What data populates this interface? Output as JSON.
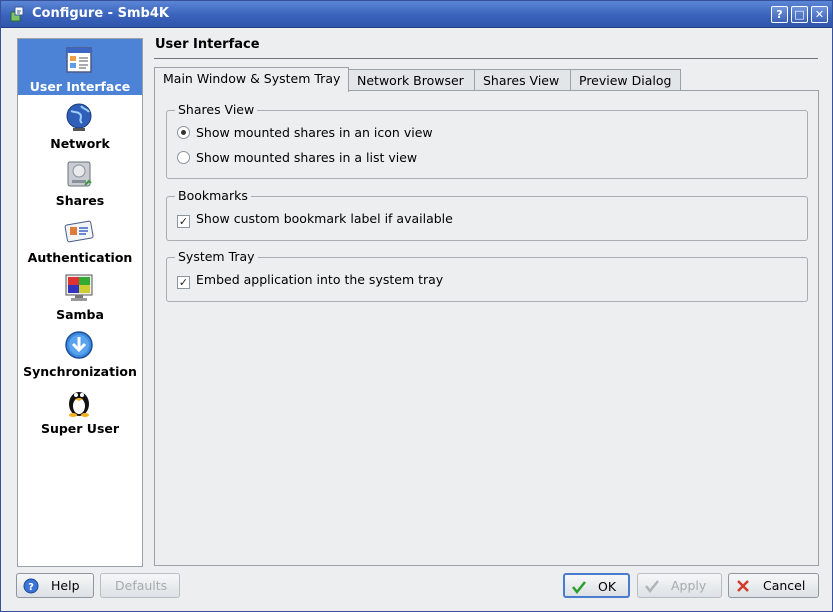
{
  "window": {
    "title": "Configure - Smb4K"
  },
  "titlebar": {
    "help_glyph": "?",
    "max_glyph": "□",
    "close_glyph": "✕"
  },
  "sidebar": {
    "items": [
      {
        "label": "User Interface",
        "icon": "user-interface-icon",
        "selected": true
      },
      {
        "label": "Network",
        "icon": "network-globe-icon",
        "selected": false
      },
      {
        "label": "Shares",
        "icon": "shares-drive-icon",
        "selected": false
      },
      {
        "label": "Authentication",
        "icon": "authentication-card-icon",
        "selected": false
      },
      {
        "label": "Samba",
        "icon": "samba-monitor-icon",
        "selected": false
      },
      {
        "label": "Synchronization",
        "icon": "synchronization-icon",
        "selected": false
      },
      {
        "label": "Super User",
        "icon": "tux-penguin-icon",
        "selected": false
      }
    ]
  },
  "page": {
    "title": "User Interface"
  },
  "tabs": [
    {
      "label": "Main Window & System Tray",
      "active": true
    },
    {
      "label": "Network Browser",
      "active": false
    },
    {
      "label": "Shares View",
      "active": false
    },
    {
      "label": "Preview Dialog",
      "active": false
    }
  ],
  "groups": {
    "shares_view": {
      "title": "Shares View",
      "options": [
        {
          "label": "Show mounted shares in an icon view",
          "checked": true
        },
        {
          "label": "Show mounted shares in a list view",
          "checked": false
        }
      ]
    },
    "bookmarks": {
      "title": "Bookmarks",
      "options": [
        {
          "label": "Show custom bookmark label if available",
          "checked": true
        }
      ]
    },
    "system_tray": {
      "title": "System Tray",
      "options": [
        {
          "label": "Embed application into the system tray",
          "checked": true
        }
      ]
    }
  },
  "buttons": {
    "help": "Help",
    "defaults": "Defaults",
    "ok": "OK",
    "apply": "Apply",
    "cancel": "Cancel"
  },
  "colors": {
    "titlebar": "#3a63bd",
    "selection": "#4c83d6"
  }
}
